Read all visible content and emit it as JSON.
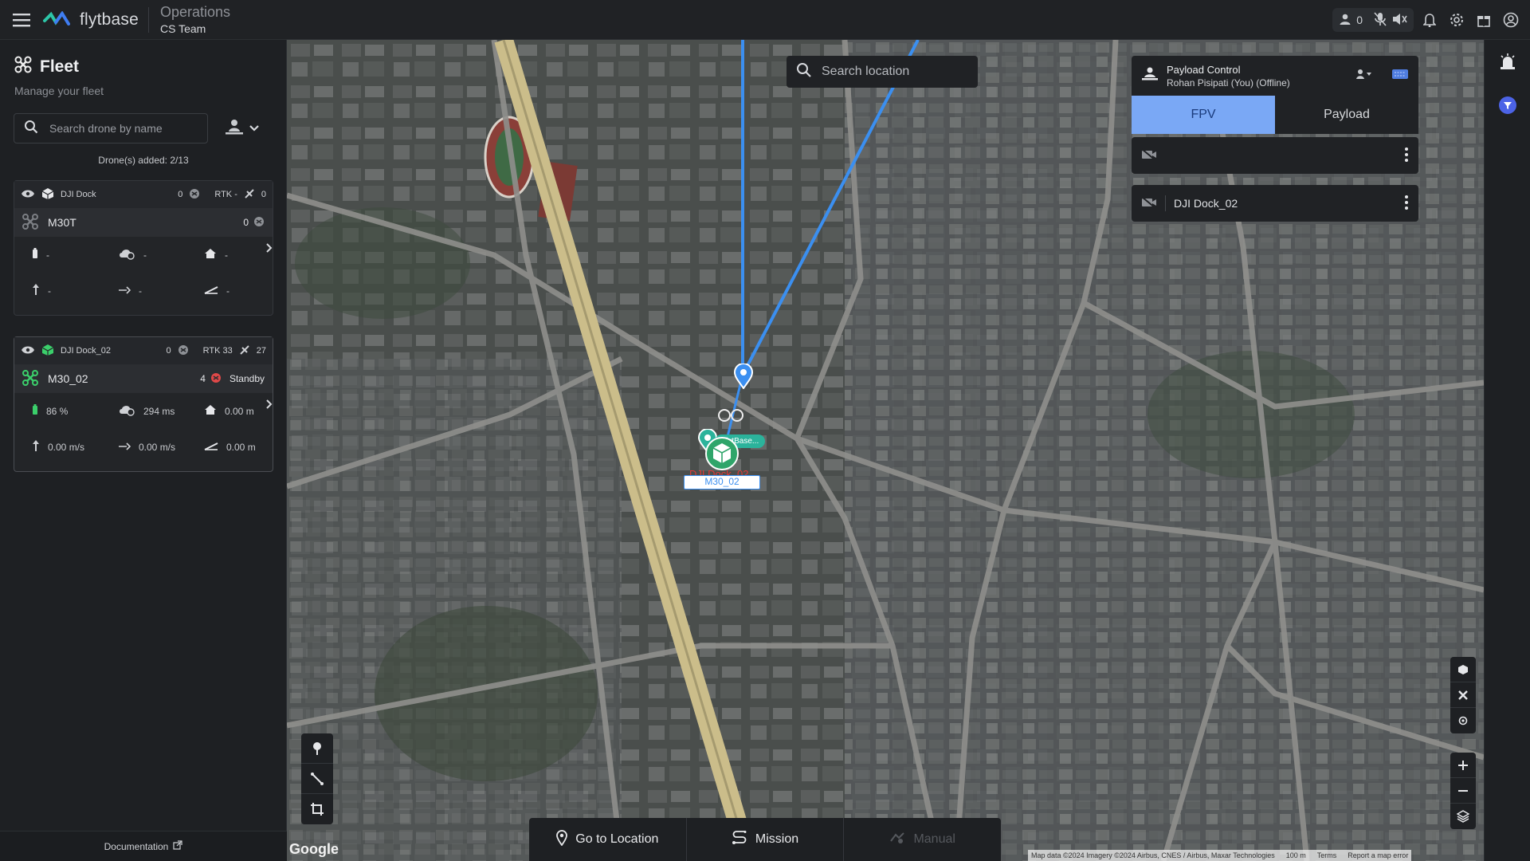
{
  "header": {
    "brand": "flytbase",
    "title": "Operations",
    "team": "CS Team",
    "users_online": "0"
  },
  "sidebar": {
    "title": "Fleet",
    "subtitle": "Manage your fleet",
    "search_placeholder": "Search drone by name",
    "drones_added": "Drone(s) added: 2/13",
    "documentation": "Documentation"
  },
  "cards": [
    {
      "dock_name": "DJI Dock",
      "dock_count": "0",
      "rtk": "RTK -",
      "sat": "0",
      "drone_name": "M30T",
      "drone_count": "0",
      "status": "",
      "battery": "-",
      "latency": "-",
      "home_dist": "-",
      "vspeed": "-",
      "hspeed": "-",
      "altitude": "-"
    },
    {
      "dock_name": "DJI Dock_02",
      "dock_count": "0",
      "rtk": "RTK 33",
      "sat": "27",
      "drone_name": "M30_02",
      "drone_count": "4",
      "status": "Standby",
      "battery": "86 %",
      "latency": "294 ms",
      "home_dist": "0.00 m",
      "vspeed": "0.00 m/s",
      "hspeed": "0.00 m/s",
      "altitude": "0.00 m"
    }
  ],
  "map": {
    "search_placeholder": "Search location",
    "dock_label": "DJI Dock_02",
    "drone_label": "M30_02",
    "base_label": "FlytBase..."
  },
  "payload_panel": {
    "title": "Payload Control",
    "subtitle": "Rohan Pisipati (You) (Offline)",
    "tabs": [
      "FPV",
      "Payload"
    ],
    "active_tab": "FPV",
    "camera_row_2": "DJI Dock_02"
  },
  "bottom_bar": {
    "go_to_location": "Go to Location",
    "mission": "Mission",
    "manual": "Manual"
  },
  "attribution": {
    "google": "Google",
    "map_data": "Map data ©2024 Imagery ©2024 Airbus, CNES / Airbus, Maxar Technologies",
    "scale": "100 m",
    "terms": "Terms",
    "report": "Report a map error"
  },
  "colors": {
    "accent_blue": "#7aa8f5",
    "route_blue": "#3b8ff0",
    "drone_green": "#3bcf6b",
    "status_red": "#e04848"
  }
}
